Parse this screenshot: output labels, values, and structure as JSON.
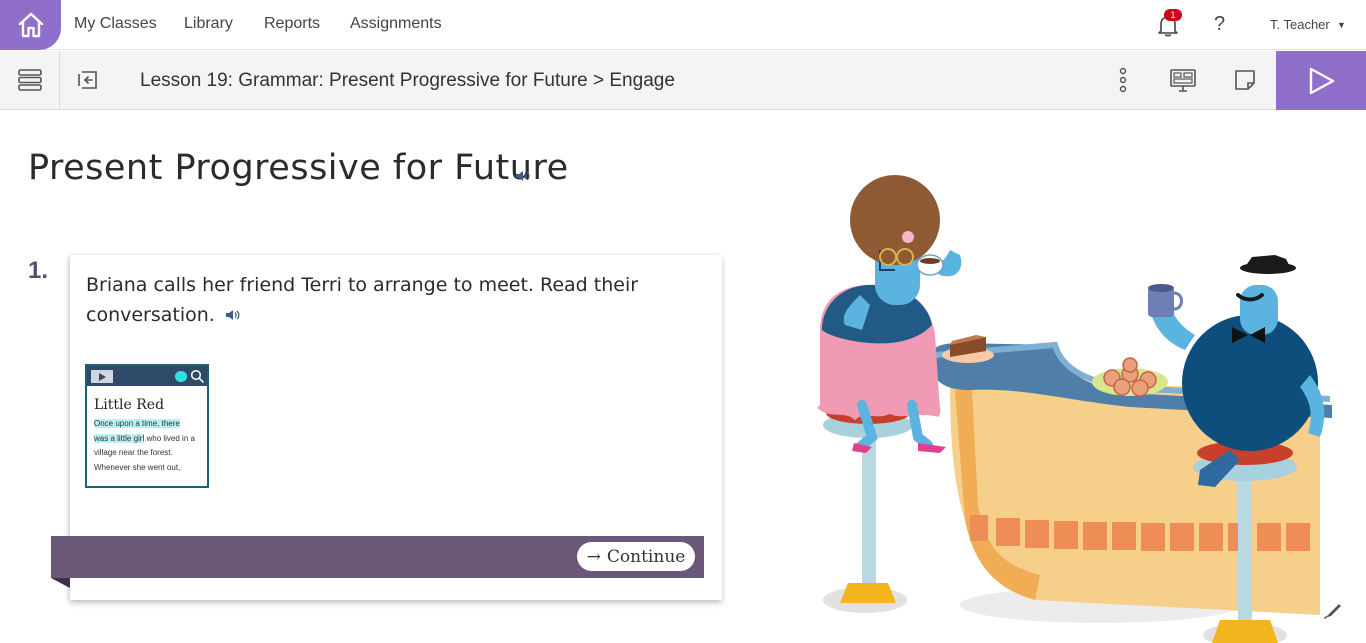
{
  "nav": {
    "links": [
      "My Classes",
      "Library",
      "Reports",
      "Assignments"
    ],
    "notification_count": "1",
    "help": "?",
    "user": "T. Teacher"
  },
  "lesson": {
    "breadcrumb": "Lesson 19: Grammar: Present Progressive for Future > Engage"
  },
  "content": {
    "title": "Present Progressive for Future",
    "question_number": "1.",
    "question_text": "Briana calls her friend Terri to arrange to meet. Read their conversation.",
    "thumbnail": {
      "title": "Little Red",
      "lines": [
        {
          "hl": "Once upon a time, there",
          "rest": ""
        },
        {
          "hl": "was a little girl",
          "rest": " who lived in a"
        },
        {
          "hl": "",
          "rest": "village near the forest."
        },
        {
          "hl": "",
          "rest": "Whenever she went out,"
        }
      ]
    },
    "continue_label": "Continue"
  },
  "colors": {
    "brand_purple": "#8f6fc9",
    "banner": "#6b5878",
    "question_number": "#5c4a73"
  },
  "icons": [
    "home-icon",
    "bell-icon",
    "help-icon",
    "menu-lines-icon",
    "return-icon",
    "more-vertical-icon",
    "presentation-icon",
    "note-icon",
    "play-icon",
    "speaker-icon",
    "search-icon",
    "arrow-right-icon"
  ]
}
